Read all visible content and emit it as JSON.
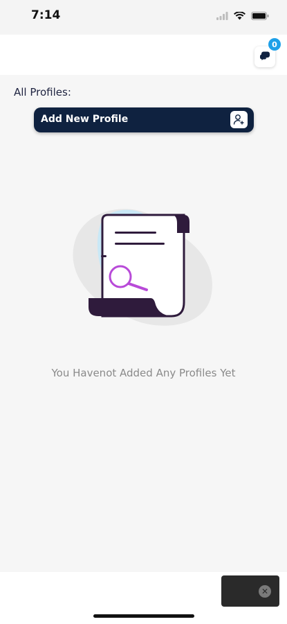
{
  "status_bar": {
    "time": "7:14"
  },
  "header": {
    "chat_badge_count": "0"
  },
  "profiles": {
    "section_title": "All Profiles:",
    "add_button_label": "Add New Profile",
    "empty_message": "You Havenot Added Any Profiles Yet"
  },
  "icons": {
    "chat": "chat-bubble-icon",
    "add_profile": "add-user-icon",
    "empty_state": "document-search-illustration",
    "ad_close": "close-icon"
  },
  "colors": {
    "primary": "#0f2240",
    "badge": "#1ea0e8",
    "illustration_dark": "#2f1b3c",
    "illustration_accent": "#b84ad8"
  },
  "ad": {
    "close_glyph": "✕"
  }
}
